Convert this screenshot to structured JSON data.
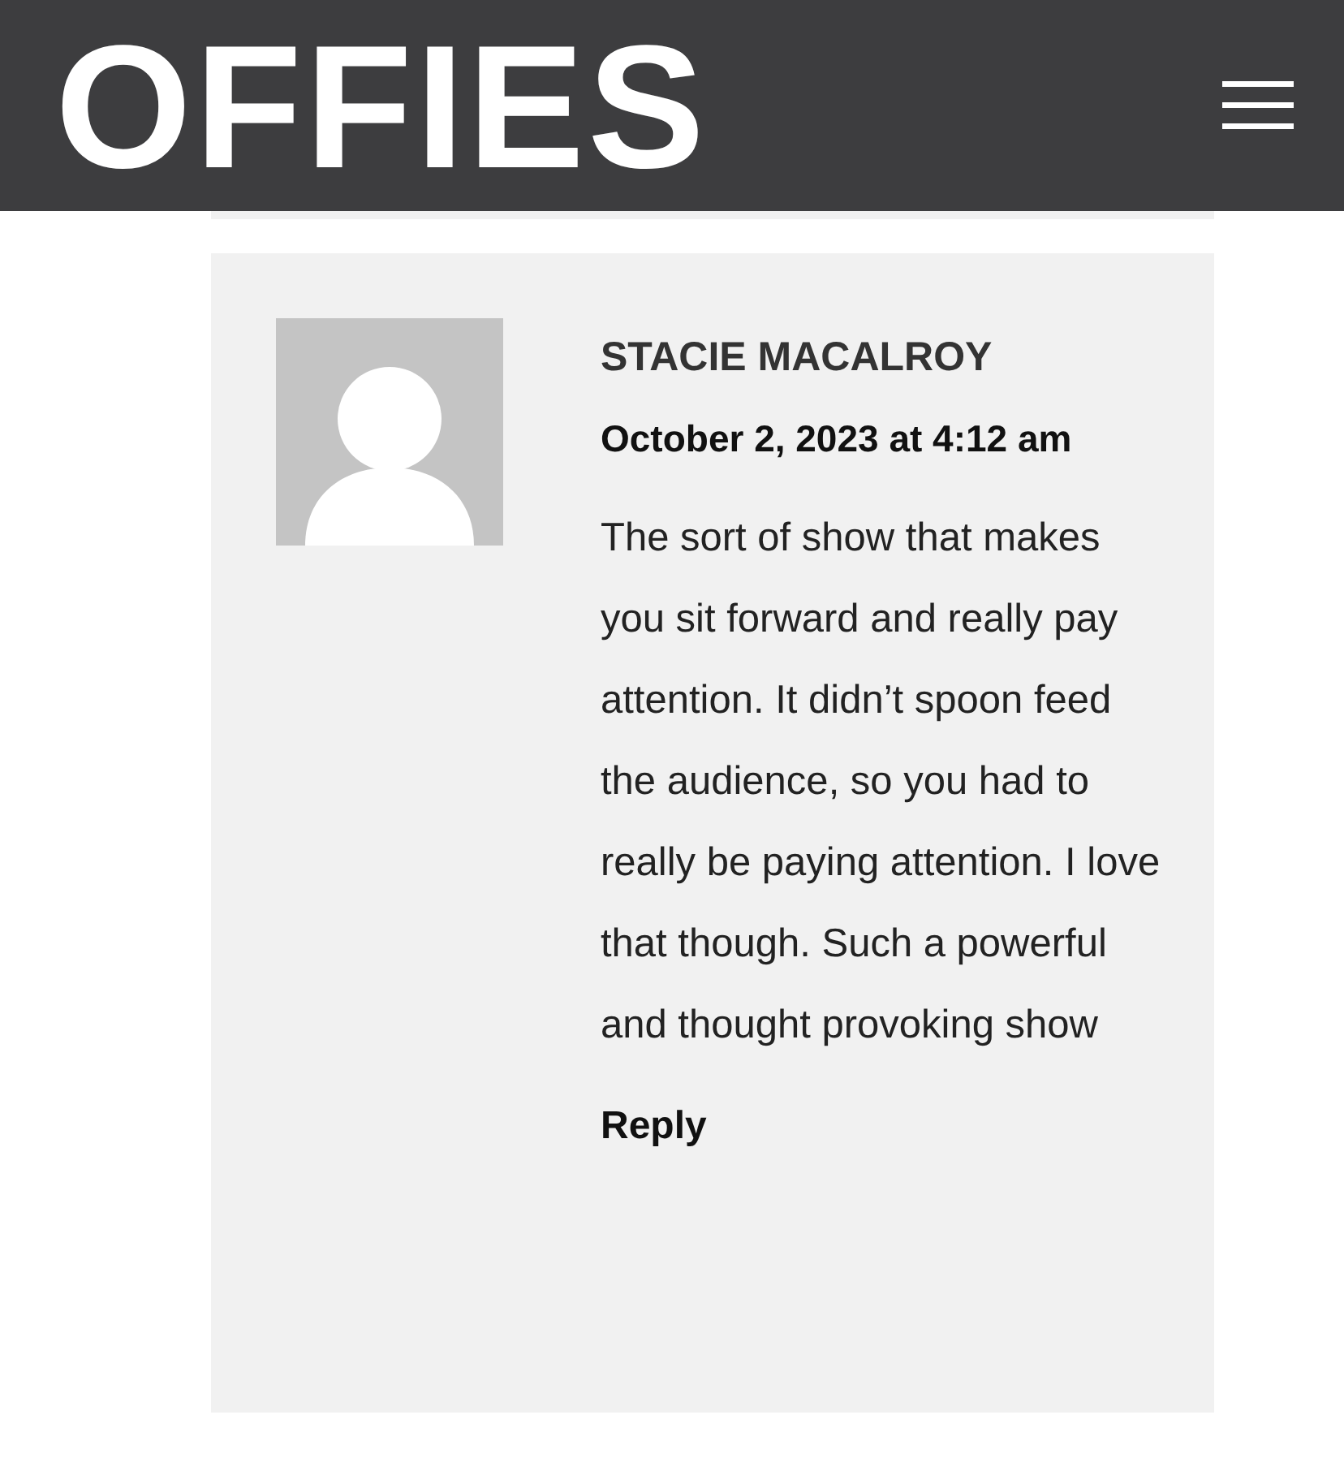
{
  "header": {
    "logo": "OFFIES"
  },
  "comments": [
    {
      "author": "STACIE MACALROY",
      "date": "October 2, 2023 at 4:12 am",
      "text": "The sort of show that makes you sit forward and really pay attention. It didn’t spoon feed the audience, so you had to really be paying attention. I love that though. Such a powerful and thought provoking show",
      "reply": "Reply"
    }
  ]
}
